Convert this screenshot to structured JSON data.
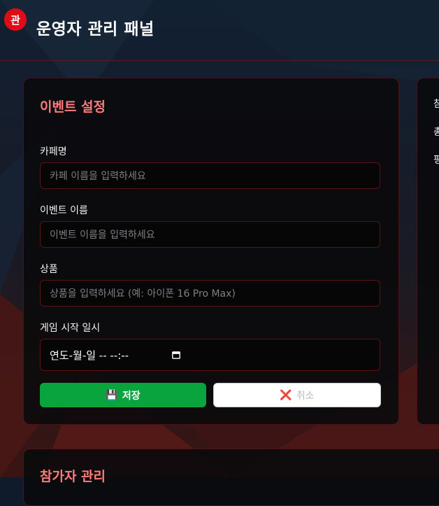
{
  "header": {
    "logo_text": "관",
    "title": "운영자 관리 패널"
  },
  "event_settings": {
    "title": "이벤트 설정",
    "cafe_label": "카페명",
    "cafe_placeholder": "카페 이름을 입력하세요",
    "event_label": "이벤트 이름",
    "event_placeholder": "이벤트 이름을 입력하세요",
    "product_label": "상품",
    "product_placeholder": "상품을 입력하세요 (예: 아이폰 16 Pro Max)",
    "start_label": "게임 시작 일시",
    "start_value": "연도-월-일 -- --:--",
    "save_icon": "💾",
    "save_label": "저장",
    "cancel_icon": "❌",
    "cancel_label": "취소"
  },
  "stats_panel": {
    "line1": "참",
    "line2": "총",
    "line3": "평"
  },
  "participants": {
    "title": "참가자 관리"
  },
  "colors": {
    "accent": "#ff7b7b",
    "save": "#0aa43f",
    "logo": "#e10b16"
  }
}
